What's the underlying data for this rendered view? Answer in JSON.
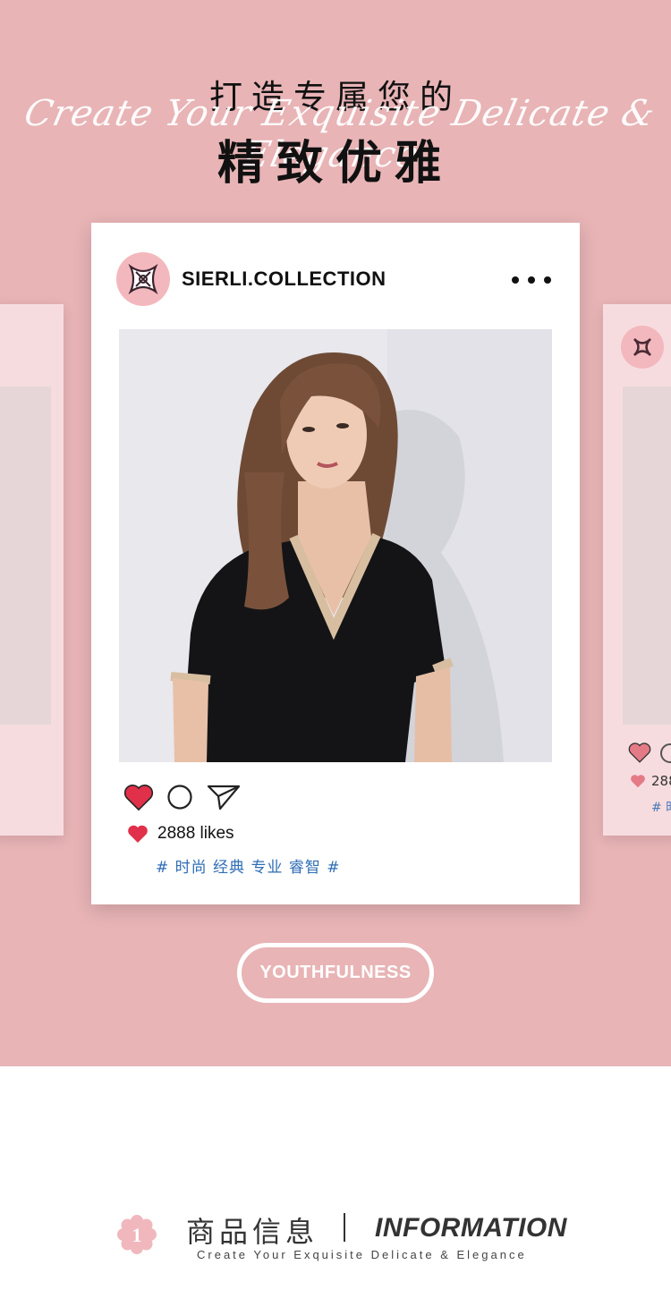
{
  "header": {
    "title_top": "打造专属您的",
    "script_text": "Create Your Exquisite Delicate & Elegance",
    "title_main": "精致优雅"
  },
  "post": {
    "username": "SIERLI.COLLECTION",
    "likes_text": "2888 likes",
    "tags": "# 时尚 经典 专业 睿智 #"
  },
  "side_card_right": {
    "likes_text": "288",
    "tags": "# 时"
  },
  "button": {
    "label": "YOUTHFULNESS"
  },
  "info": {
    "number": "1",
    "title_cn": "商品信息",
    "title_en": "INFORMATION",
    "subtitle": "Create Your Exquisite Delicate & Elegance"
  },
  "colors": {
    "hero_bg": "#e8b4b6",
    "heart": "#e0304a",
    "tag_text": "#2f6db5",
    "badge": "#f0b8bd"
  },
  "icons": [
    "more-icon",
    "heart-icon",
    "comment-icon",
    "share-icon",
    "logo-icon",
    "flower-badge-icon"
  ]
}
